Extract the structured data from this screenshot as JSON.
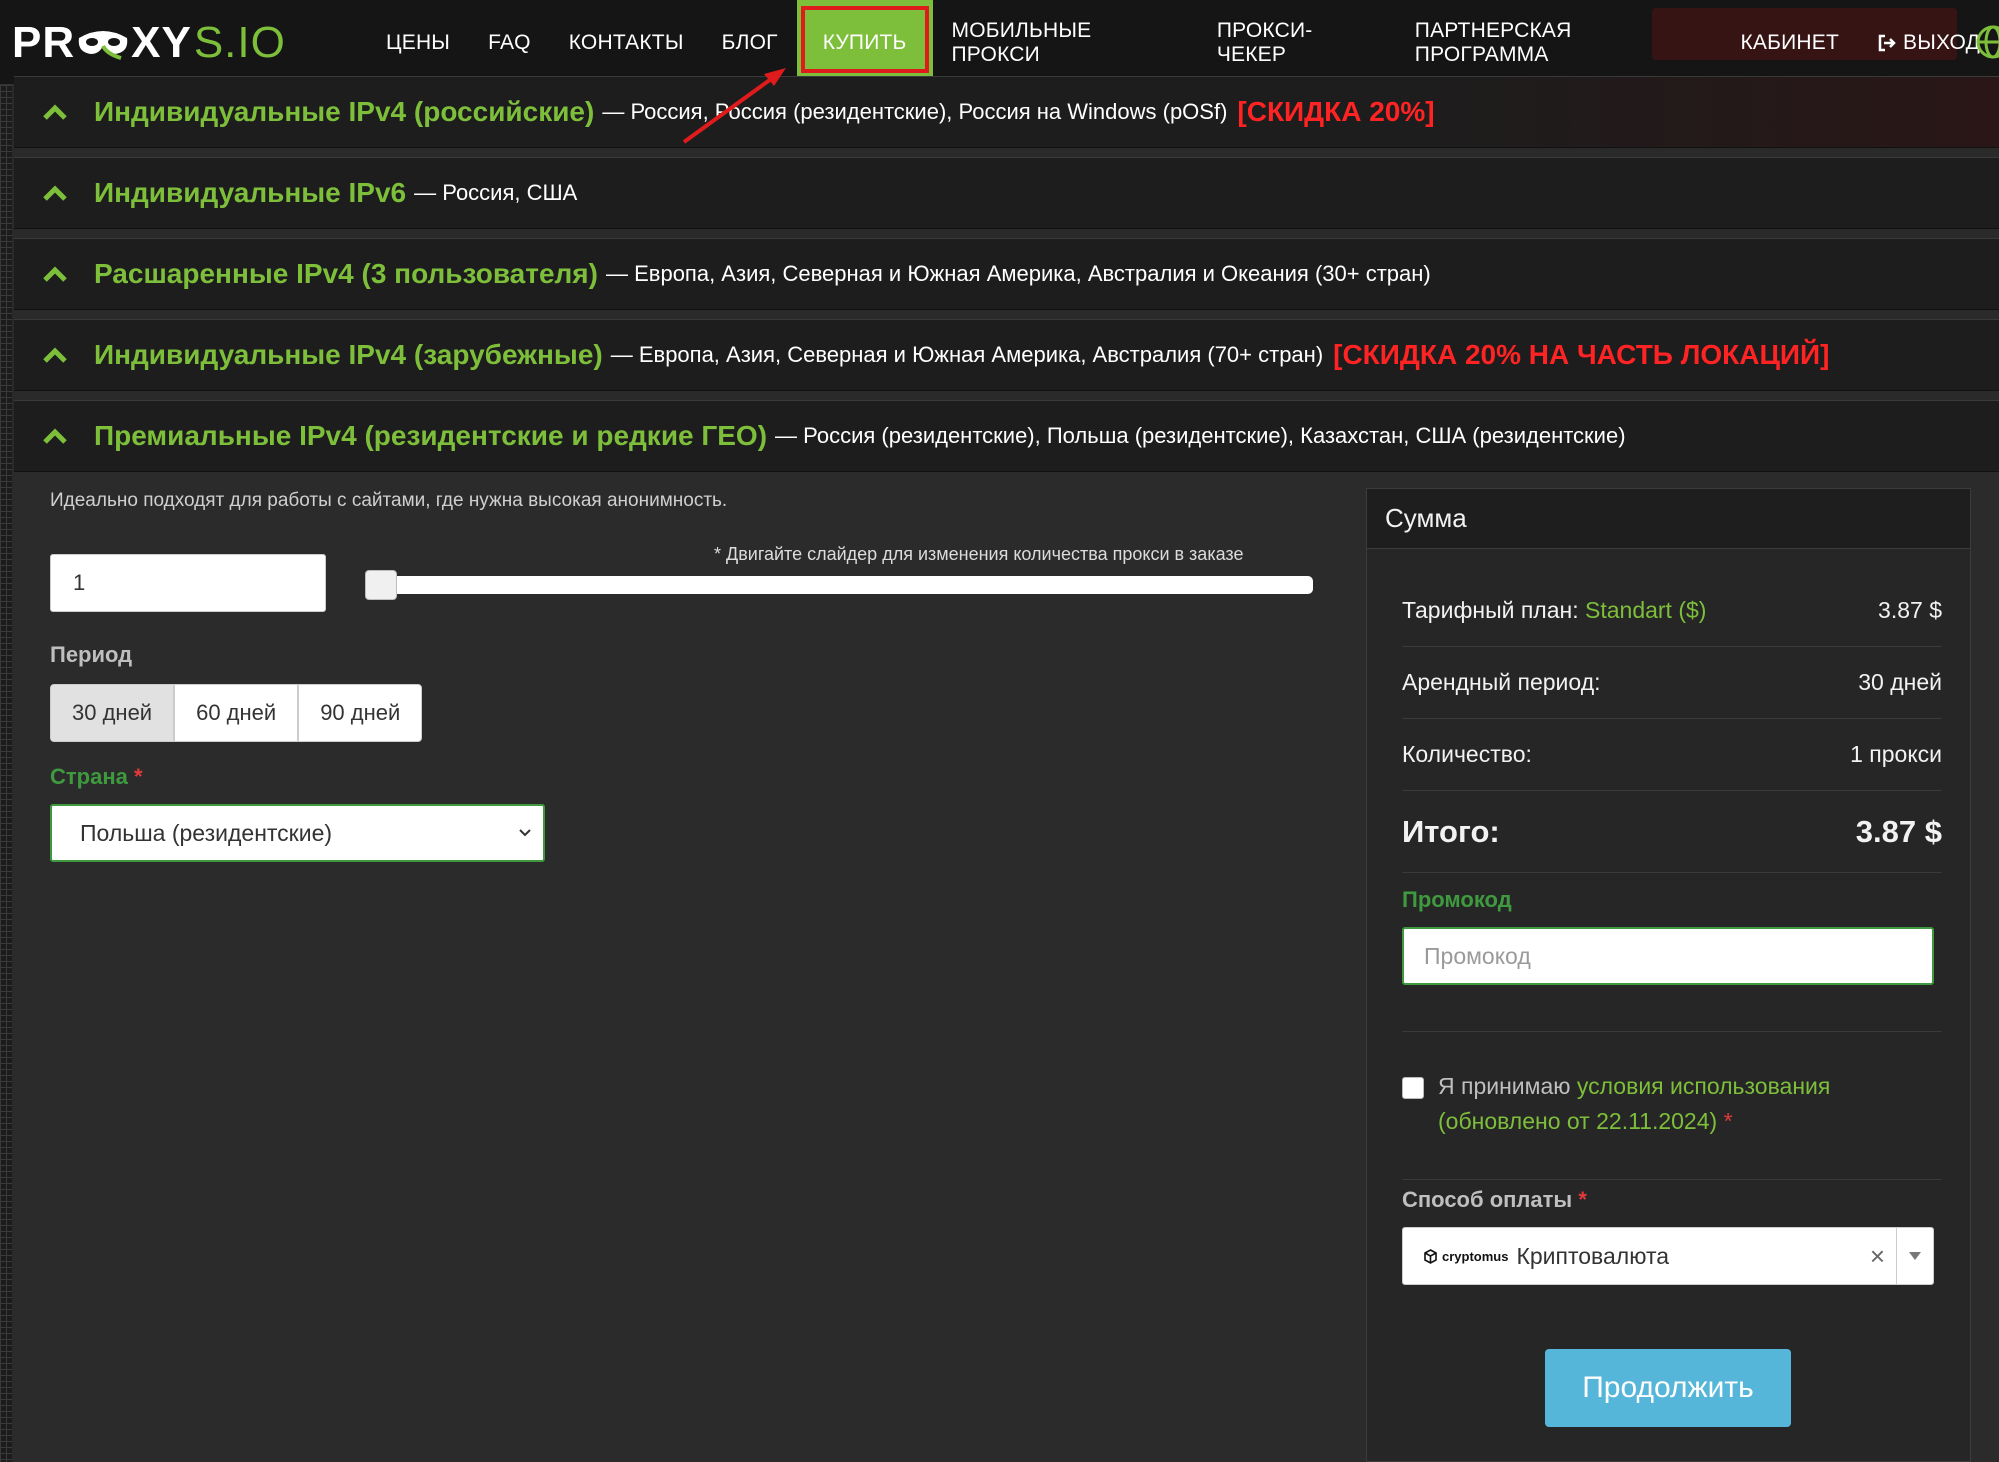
{
  "logo": {
    "pr": "PR",
    "xy": "XY",
    "domain": "S.IO"
  },
  "nav": {
    "items": [
      {
        "label": "ЦЕНЫ"
      },
      {
        "label": "FAQ"
      },
      {
        "label": "КОНТАКТЫ"
      },
      {
        "label": "БЛОГ"
      },
      {
        "label": "КУПИТЬ"
      },
      {
        "label": "МОБИЛЬНЫЕ ПРОКСИ"
      },
      {
        "label": "ПРОКСИ-ЧЕКЕР"
      },
      {
        "label": "ПАРТНЕРСКАЯ ПРОГРАММА"
      },
      {
        "label": "КАБИНЕТ"
      },
      {
        "label": "ВЫХОД"
      }
    ]
  },
  "accordions": [
    {
      "title": "Индивидуальные IPv4 (российские)",
      "desc": "— Россия, Россия (резидентские), Россия на Windows (pOSf)",
      "promo": "[СКИДКА 20%]"
    },
    {
      "title": "Индивидуальные IPv6",
      "desc": "— Россия, США",
      "promo": ""
    },
    {
      "title": "Расшаренные IPv4 (3 пользователя)",
      "desc": "— Европа, Азия, Северная и Южная Америка, Австралия и Океания (30+ стран)",
      "promo": ""
    },
    {
      "title": "Индивидуальные IPv4 (зарубежные)",
      "desc": "— Европа, Азия, Северная и Южная Америка, Австралия (70+ стран)",
      "promo": "[СКИДКА 20% НА ЧАСТЬ ЛОКАЦИЙ]"
    },
    {
      "title": "Премиальные IPv4 (резидентские и редкие ГЕО)",
      "desc": "— Россия (резидентские), Польша (резидентские), Казахстан, США (резидентские)",
      "promo": ""
    }
  ],
  "order": {
    "intro": "Идеально подходят для работы с сайтами, где нужна высокая анонимность.",
    "quantity_value": "1",
    "slider_hint": "* Двигайте слайдер для изменения количества прокси в заказе",
    "slider_fraction": 0.0,
    "period_label": "Период",
    "periods": [
      "30 дней",
      "60 дней",
      "90 дней"
    ],
    "selected_period": "30 дней",
    "country_label": "Страна",
    "required_mark": "*",
    "country_value": "Польша (резидентские)"
  },
  "summary": {
    "title": "Сумма",
    "plan_label": "Тарифный план:",
    "plan_name": "Standart ($)",
    "plan_price": "3.87 $",
    "period_label": "Арендный период:",
    "period_value": "30 дней",
    "qty_label": "Количество:",
    "qty_value": "1 прокси",
    "total_label": "Итого:",
    "total_value": "3.87 $",
    "promo_label": "Промокод",
    "promo_placeholder": "Промокод",
    "terms_prefix": "Я принимаю",
    "terms_link": "условия использования (обновлено от 22.11.2024)",
    "required_mark": "*",
    "pay_label": "Способ оплаты",
    "pay_brand": "cryptomus",
    "pay_value": "Криптовалюта",
    "pay_clear": "×",
    "continue_label": "Продолжить"
  },
  "colors": {
    "accent": "#7dbf3a",
    "promo_red": "#ff2323",
    "highlight_box": "#e01b1b",
    "continue_button": "#56b6d9",
    "background": "#2a2a2a"
  }
}
